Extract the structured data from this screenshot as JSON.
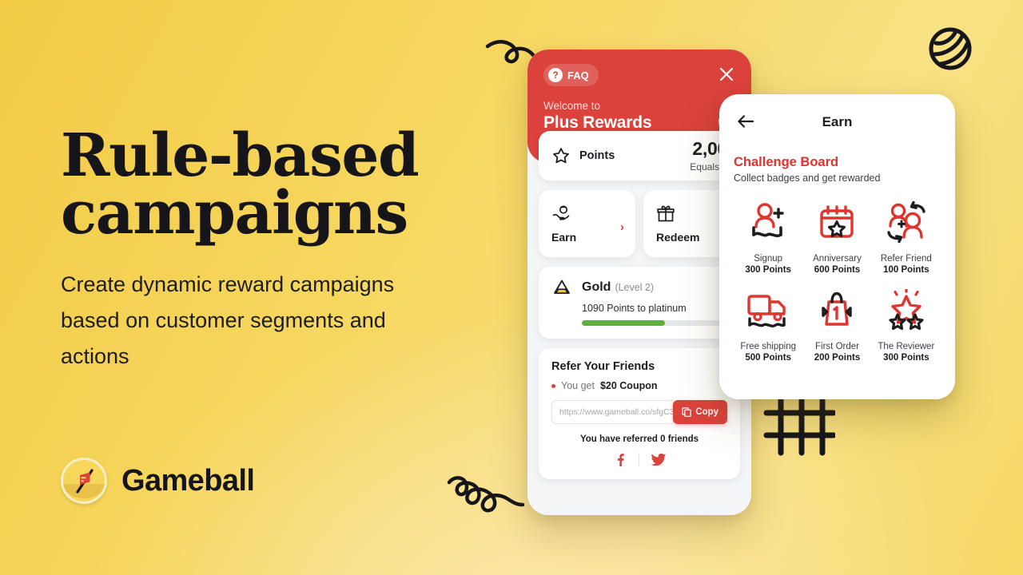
{
  "hero": {
    "title_line1": "Rule-based",
    "title_line2": "campaigns",
    "subtitle": "Create dynamic reward campaigns based on customer segments and actions"
  },
  "brand": {
    "name": "Gameball",
    "logo_icon": "flag-coin-icon",
    "corner_icon": "gameball-sphere-icon"
  },
  "decorations": {
    "squiggle_top": "loop-squiggle-icon",
    "squiggle_bottom": "spiral-squiggle-icon",
    "grid": "tic-tac-toe-grid-icon"
  },
  "widget": {
    "faq_label": "FAQ",
    "faq_icon": "question-mark-icon",
    "close_icon": "close-icon",
    "history_icon": "history-clock-icon",
    "welcome_eyebrow": "Welcome to",
    "program_name": "Plus Rewards",
    "points": {
      "icon": "star-icon",
      "label": "Points",
      "value": "2,00",
      "equals": "Equals $"
    },
    "tiles": [
      {
        "label": "Earn",
        "icon": "hand-coin-icon",
        "chevron": "›"
      },
      {
        "label": "Redeem",
        "icon": "gift-icon",
        "chevron": ""
      }
    ],
    "tier": {
      "icon": "tier-pyramid-icon",
      "name": "Gold",
      "level": "(Level 2)",
      "progress_text": "1090 Points to platinum",
      "progress_percent": 57,
      "progress_color": "#5fae3e"
    },
    "refer": {
      "title": "Refer Your Friends",
      "you_get_prefix": "You get",
      "you_get_value": "$20 Coupon",
      "link_placeholder": "https://www.gameball.co/sfgC3..",
      "copy_label": "Copy",
      "copy_icon": "copy-icon",
      "referred_text": "You have referred 0 friends",
      "social_icons": [
        "facebook-icon",
        "twitter-icon"
      ],
      "chevron": "›"
    }
  },
  "earn_panel": {
    "back_icon": "back-arrow-icon",
    "title": "Earn",
    "board_title": "Challenge Board",
    "board_subtitle": "Collect badges and get rewarded",
    "badges": [
      {
        "name": "Signup",
        "points": "300 Points",
        "icon": "signup-person-plus-icon"
      },
      {
        "name": "Anniversary",
        "points": "600 Points",
        "icon": "calendar-star-icon"
      },
      {
        "name": "Refer Friend",
        "points": "100 Points",
        "icon": "refer-two-people-icon"
      },
      {
        "name": "Free shipping",
        "points": "500 Points",
        "icon": "delivery-truck-icon"
      },
      {
        "name": "First Order",
        "points": "200 Points",
        "icon": "shopping-bag-one-icon"
      },
      {
        "name": "The Reviewer",
        "points": "300 Points",
        "icon": "triple-star-icon"
      }
    ]
  },
  "colors": {
    "brand_red": "#db423c",
    "accent_red": "#e0352f",
    "background_yellow": "#f6d75f",
    "progress_green": "#5fae3e",
    "ink": "#1d1d20"
  }
}
